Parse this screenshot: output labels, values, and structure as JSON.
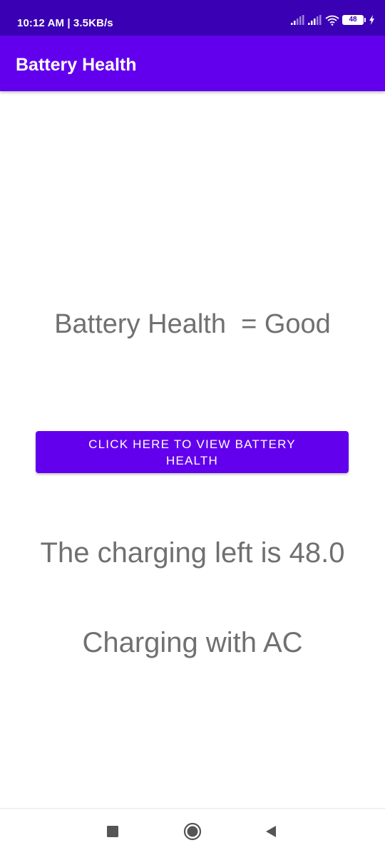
{
  "status_bar": {
    "time_speed": "10:12 AM | 3.5KB/s",
    "battery_level": "48",
    "icons": [
      "signal-icon",
      "signal-icon",
      "wifi-icon",
      "battery-icon",
      "charging-bolt-icon"
    ]
  },
  "app_bar": {
    "title": "Battery Health"
  },
  "main": {
    "health_text": "Battery Health  = Good",
    "view_button_label": "CLICK HERE TO VIEW BATTERY HEALTH",
    "charging_left_text": "The charging left is 48.0",
    "charging_source_text": "Charging with AC"
  },
  "nav_bar": {
    "icons": [
      "recent-apps-icon",
      "home-icon",
      "back-icon"
    ]
  },
  "colors": {
    "status_bar": "#3a00b3",
    "app_bar": "#6200ee",
    "button": "#6200ee",
    "body_text": "#707070"
  }
}
